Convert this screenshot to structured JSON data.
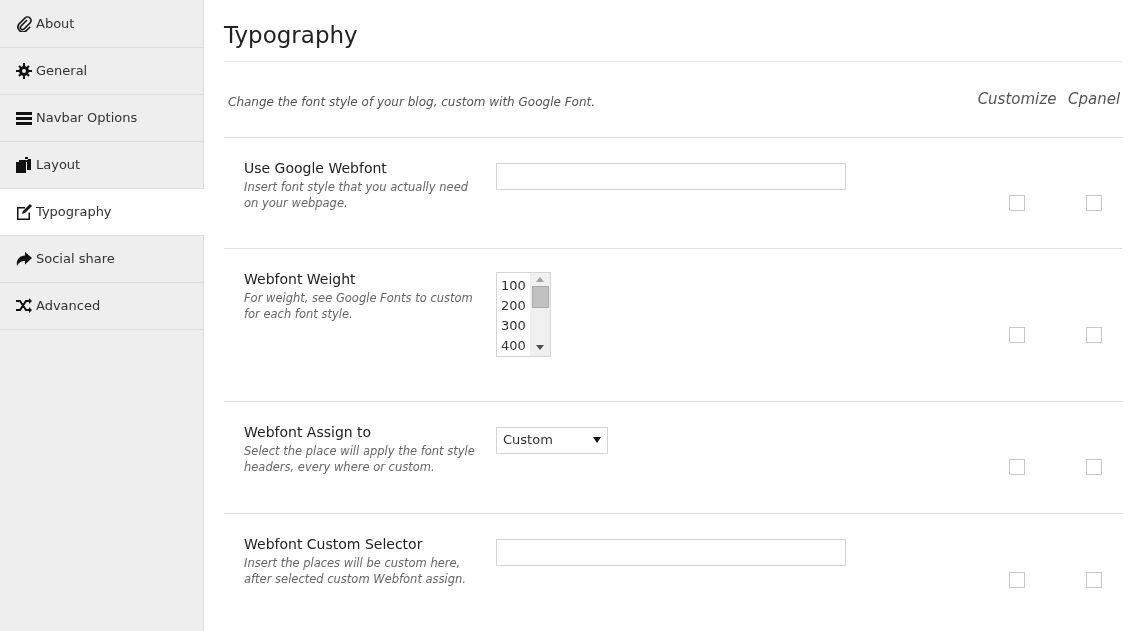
{
  "sidebar": {
    "items": [
      {
        "label": "About",
        "kind": "paperclip",
        "selected": false
      },
      {
        "label": "General",
        "kind": "gear",
        "selected": false
      },
      {
        "label": "Navbar Options",
        "kind": "bars",
        "selected": false
      },
      {
        "label": "Layout",
        "kind": "copies",
        "selected": false
      },
      {
        "label": "Typography",
        "kind": "edit",
        "selected": true
      },
      {
        "label": "Social share",
        "kind": "share",
        "selected": false
      },
      {
        "label": "Advanced",
        "kind": "shuffle",
        "selected": false
      }
    ]
  },
  "page": {
    "title": "Typography",
    "description": "Change the font style of your blog, custom with Google Font.",
    "column_headers": [
      "Customize",
      "Cpanel"
    ]
  },
  "settings": [
    {
      "label": "Use Google Webfont",
      "help": "Insert font style that you actually need on your webpage.",
      "kind": "text",
      "customize": false,
      "cpanel": false
    },
    {
      "label": "Webfont Weight",
      "help": "For weight, see Google Fonts to custom for each font style.",
      "kind": "listbox",
      "options": [
        "100",
        "200",
        "300",
        "400"
      ],
      "customize": false,
      "cpanel": false
    },
    {
      "label": "Webfont Assign to",
      "help": "Select the place will apply the font style headers, every where or custom.",
      "kind": "select",
      "value": "Custom",
      "customize": false,
      "cpanel": false
    },
    {
      "label": "Webfont Custom Selector",
      "help": "Insert the places will be custom here, after selected custom Webfont assign.",
      "kind": "text",
      "customize": false,
      "cpanel": false
    }
  ]
}
